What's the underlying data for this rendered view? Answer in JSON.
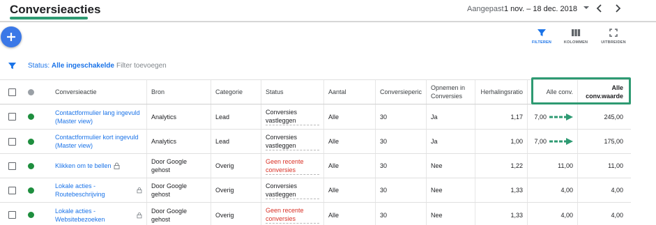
{
  "header": {
    "title": "Conversieacties",
    "date_label": "Aangepast",
    "date_range": "1 nov. – 18 dec. 2018"
  },
  "toolbar": {
    "filter_label": "FILTEREN",
    "columns_label": "KOLOMMEN",
    "expand_label": "UITBREIDEN"
  },
  "filterbar": {
    "status_prefix": "Status:",
    "status_value": "Alle ingeschakelde",
    "add_filter": "Filter toevoegen"
  },
  "table": {
    "headers": {
      "action": "Conversieactie",
      "source": "Bron",
      "category": "Categorie",
      "status": "Status",
      "count": "Aantal",
      "period": "Conversieperic",
      "include": "Opnemen in Conversies",
      "ratio": "Herhalingsratio",
      "all_conv": "Alle conv.",
      "all_value": "Alle conv.waarde"
    },
    "rows": [
      {
        "action": "Contactformulier lang ingevuld (Master view)",
        "source": "Analytics",
        "category": "Lead",
        "status": "Conversies vastleggen",
        "status_color": "#202124",
        "count": "Alle",
        "period": "30",
        "include": "Ja",
        "ratio": "1,17",
        "all_conv": "7,00",
        "all_value": "245,00",
        "arrow": true,
        "locked": false
      },
      {
        "action": "Contactformulier kort ingevuld (Master view)",
        "source": "Analytics",
        "category": "Lead",
        "status": "Conversies vastleggen",
        "status_color": "#202124",
        "count": "Alle",
        "period": "30",
        "include": "Ja",
        "ratio": "1,00",
        "all_conv": "7,00",
        "all_value": "175,00",
        "arrow": true,
        "locked": false
      },
      {
        "action": "Klikken om te bellen",
        "source": "Door Google gehost",
        "category": "Overig",
        "status": "Geen recente conversies",
        "status_color": "#d93025",
        "count": "Alle",
        "period": "30",
        "include": "Nee",
        "ratio": "1,22",
        "all_conv": "11,00",
        "all_value": "11,00",
        "arrow": false,
        "locked": true
      },
      {
        "action": "Lokale acties - Routebeschrijving",
        "source": "Door Google gehost",
        "category": "Overig",
        "status": "Conversies vastleggen",
        "status_color": "#202124",
        "count": "Alle",
        "period": "30",
        "include": "Nee",
        "ratio": "1,33",
        "all_conv": "4,00",
        "all_value": "4,00",
        "arrow": false,
        "locked": true
      },
      {
        "action": "Lokale acties - Websitebezoeken",
        "source": "Door Google gehost",
        "category": "Overig",
        "status": "Geen recente conversies",
        "status_color": "#d93025",
        "count": "Alle",
        "period": "30",
        "include": "Nee",
        "ratio": "1,33",
        "all_conv": "4,00",
        "all_value": "4,00",
        "arrow": false,
        "locked": true
      }
    ]
  },
  "colors": {
    "accent": "#1a73e8",
    "highlight": "#2e9a72",
    "status_ok": "#1e8e3e",
    "status_warn": "#d93025"
  }
}
